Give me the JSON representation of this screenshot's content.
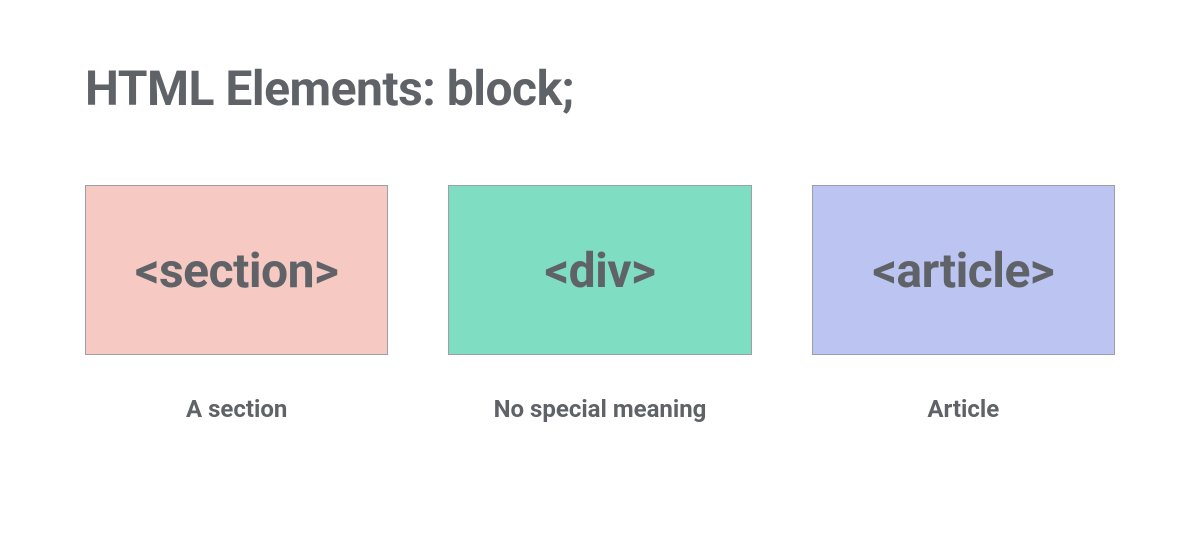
{
  "title": "HTML Elements: block;",
  "items": [
    {
      "label": "<section>",
      "caption": "A section",
      "class": "section"
    },
    {
      "label": "<div>",
      "caption": "No special meaning",
      "class": "div"
    },
    {
      "label": "<article>",
      "caption": "Article",
      "class": "article"
    }
  ]
}
